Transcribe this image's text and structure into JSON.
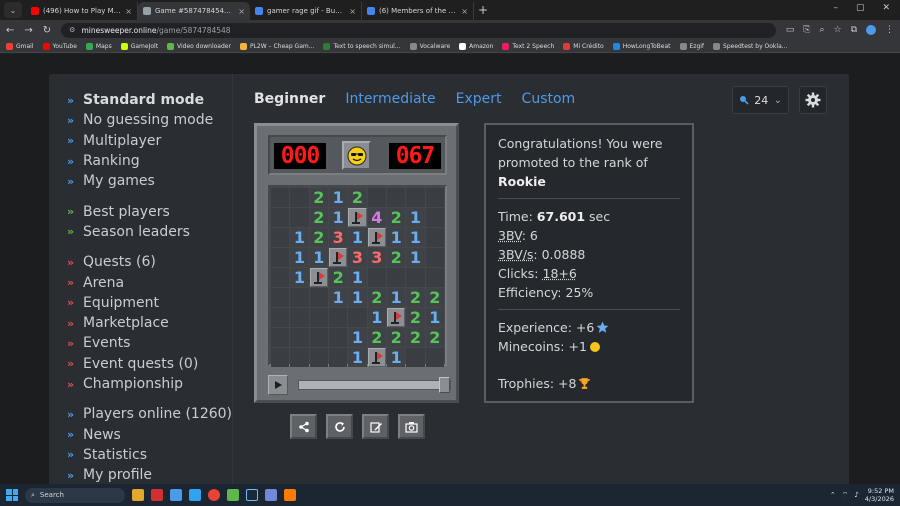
{
  "browser": {
    "tabs": [
      {
        "title": "(496) How to Play Minesweeper",
        "color": "#ff0000",
        "active": false
      },
      {
        "title": "Game #5874784548 - Minesweeper",
        "color": "#9aa0a6",
        "active": true
      },
      {
        "title": "gamer rage gif - Buscar con Google",
        "color": "#4285f4",
        "active": false
      },
      {
        "title": "(6) Members of the Five Nights",
        "color": "#4285f4",
        "active": false
      }
    ],
    "window_controls": [
      "–",
      "▢",
      "✕"
    ],
    "url_host": "minesweeper.online",
    "url_path": "/game/5874784548",
    "bookmarks": [
      {
        "label": "Gmail",
        "color": "#ea4335"
      },
      {
        "label": "YouTube",
        "color": "#ff0000"
      },
      {
        "label": "Maps",
        "color": "#34a853"
      },
      {
        "label": "GameJolt",
        "color": "#ccff00"
      },
      {
        "label": "Video downloader",
        "color": "#5fb84a"
      },
      {
        "label": "PL2W – Cheap Gam...",
        "color": "#f3b33d"
      },
      {
        "label": "Text to speech simul...",
        "color": "#2e7d32"
      },
      {
        "label": "Vocalware",
        "color": "#888888"
      },
      {
        "label": "Amazon",
        "color": "#ffffff"
      },
      {
        "label": "Text 2 Speech",
        "color": "#e91e63"
      },
      {
        "label": "Mi Crédito",
        "color": "#e53935"
      },
      {
        "label": "HowLongToBeat",
        "color": "#1e88e5"
      },
      {
        "label": "Ezgif",
        "color": "#888888"
      },
      {
        "label": "Speedtest by Ookla...",
        "color": "#888888"
      }
    ]
  },
  "sidebar": {
    "group1": [
      {
        "label": "Standard mode",
        "bold": true
      },
      {
        "label": "No guessing mode"
      },
      {
        "label": "Multiplayer"
      },
      {
        "label": "Ranking"
      },
      {
        "label": "My games"
      }
    ],
    "group2": [
      {
        "label": "Best players"
      },
      {
        "label": "Season leaders"
      }
    ],
    "group3": [
      {
        "label": "Quests (6)"
      },
      {
        "label": "Arena"
      },
      {
        "label": "Equipment"
      },
      {
        "label": "Marketplace"
      },
      {
        "label": "Events"
      },
      {
        "label": "Event quests (0)"
      },
      {
        "label": "Championship"
      }
    ],
    "group4": [
      {
        "label": "Players online (1260)"
      },
      {
        "label": "News"
      },
      {
        "label": "Statistics"
      },
      {
        "label": "My profile"
      }
    ]
  },
  "modes": [
    "Beginner",
    "Intermediate",
    "Expert",
    "Custom"
  ],
  "zoom": {
    "value": "24"
  },
  "game": {
    "mines_left": "000",
    "timer": "067",
    "board": [
      "..212....",
      "..21F421.",
      ".1231F11.",
      ".11F3321.",
      ".1F21....",
      "...112122",
      ".....1F21F",
      "....12222",
      "....1F1.."
    ],
    "replay_progress": 1.0
  },
  "result": {
    "congrats": "Congratulations! You were promoted to the rank of",
    "rank": "Rookie",
    "time_label": "Time:",
    "time_value": "67.601",
    "time_unit": "sec",
    "bv_label": "3BV",
    "bv_value": ": 6",
    "bvs_label": "3BV/s",
    "bvs_value": ": 0.0888",
    "clicks_label": "Clicks:",
    "clicks_value": "18+6",
    "efficiency": "Efficiency: 25%",
    "experience": "Experience: +6",
    "minecoins": "Minecoins: +1",
    "trophies": "Trophies: +8"
  },
  "taskbar": {
    "search_placeholder": "Search",
    "time": "9:52 PM",
    "date": "4/3/2026"
  }
}
